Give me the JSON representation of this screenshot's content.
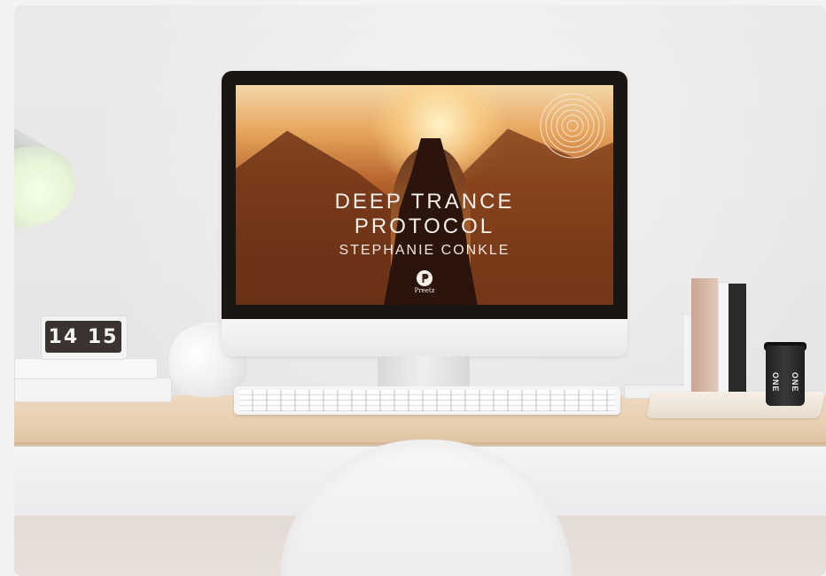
{
  "clock": {
    "time": "14 15"
  },
  "screen": {
    "title_line1": "DEEP TRANCE",
    "title_line2": "PROTOCOL",
    "subtitle": "STEPHANIE CONKLE",
    "logo_text": "Preetz"
  },
  "cup": {
    "text": "ONE ONE"
  },
  "colors": {
    "screen_warm": "#b4622b",
    "desk_wood": "#e8d0b1",
    "wall": "#ebe9e7"
  },
  "icons": [
    "lamp-icon",
    "spiral-logo-icon",
    "preetz-logo-icon"
  ]
}
